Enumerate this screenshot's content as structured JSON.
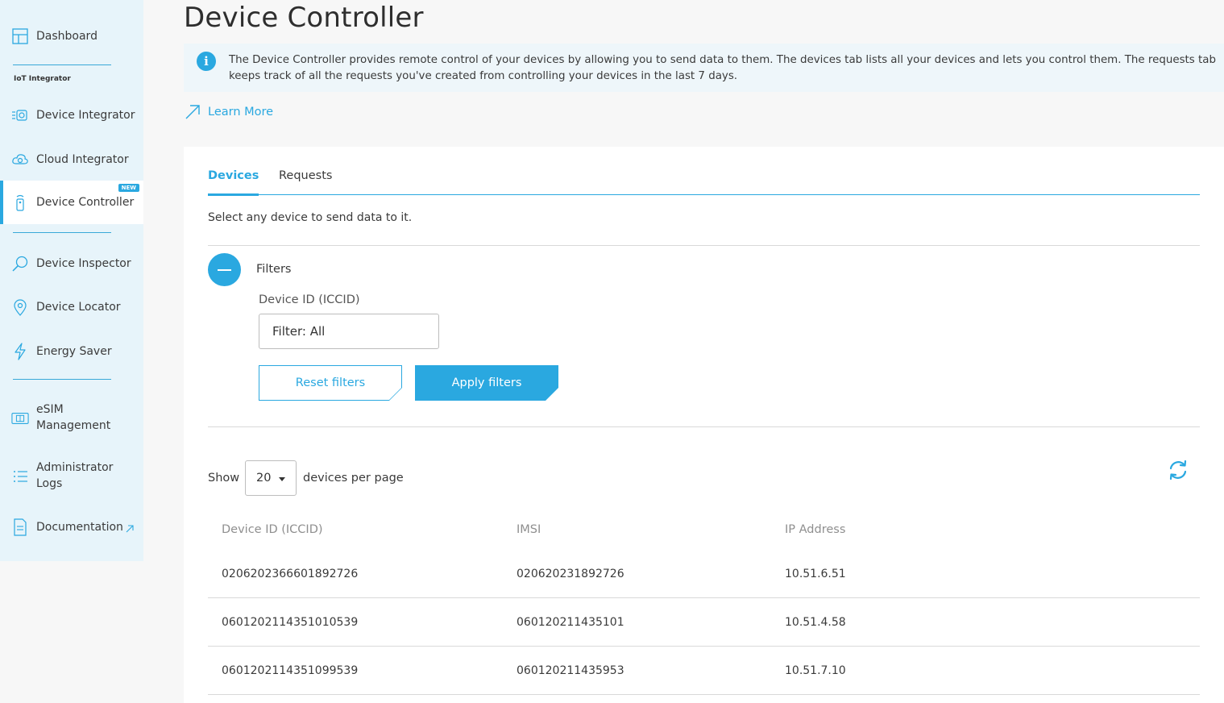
{
  "sidebar": {
    "dashboard": "Dashboard",
    "section_label": "IoT Integrator",
    "device_integrator": "Device Integrator",
    "cloud_integrator": "Cloud Integrator",
    "device_controller": "Device Controller",
    "new_badge": "NEW",
    "device_inspector": "Device Inspector",
    "device_locator": "Device Locator",
    "energy_saver": "Energy Saver",
    "esim_line1": "eSIM",
    "esim_line2": "Management",
    "admin_line1": "Administrator",
    "admin_line2": "Logs",
    "documentation": "Documentation",
    "accent_color": "#2aa8e0"
  },
  "header": {
    "title": "Device Controller",
    "info": "The Device Controller provides remote control of your devices by allowing you to send data to them. The devices tab lists all your devices and lets you control them. The requests tab keeps track of all the requests you've created from controlling your devices in the last 7 days.",
    "learn_more": "Learn More"
  },
  "tabs": {
    "devices": "Devices",
    "requests": "Requests"
  },
  "devices_tab": {
    "help": "Select any device to send data to it.",
    "filters_label": "Filters",
    "field_label": "Device ID (ICCID)",
    "filter_value": "Filter: All",
    "reset": "Reset filters",
    "apply": "Apply filters",
    "show": "Show",
    "per_page_value": "20",
    "per_page_label": "devices per page"
  },
  "table": {
    "headers": [
      "Device ID (ICCID)",
      "IMSI",
      "IP Address"
    ],
    "rows": [
      [
        "0206202366601892726",
        "020620231892726",
        "10.51.6.51"
      ],
      [
        "0601202114351010539",
        "060120211435101",
        "10.51.4.58"
      ],
      [
        "0601202114351099539",
        "060120211435953",
        "10.51.7.10"
      ]
    ]
  }
}
